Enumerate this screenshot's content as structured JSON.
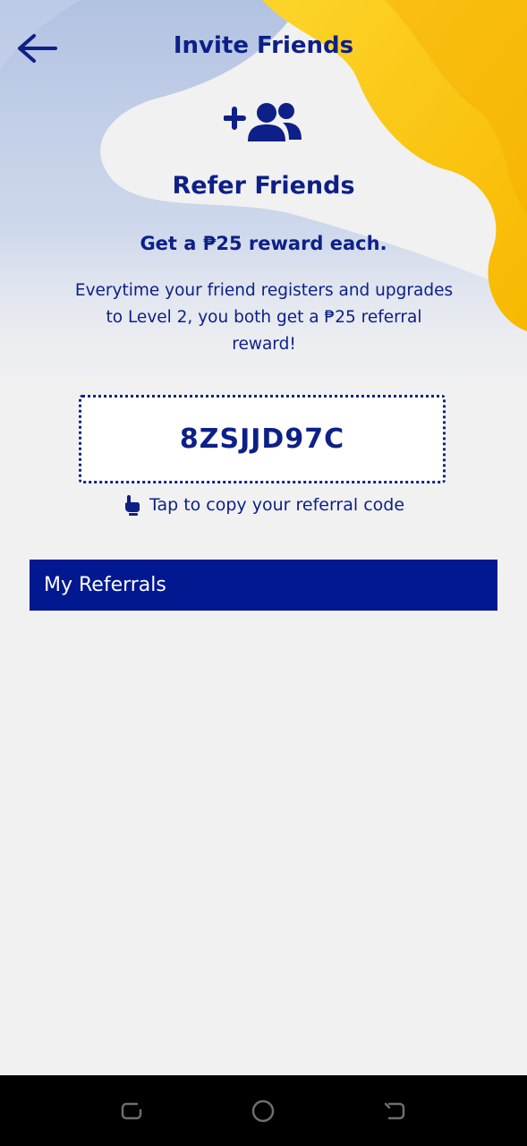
{
  "header": {
    "title": "Invite Friends",
    "back_icon": "arrow-left-icon"
  },
  "hero": {
    "icon": "add-user-group-icon",
    "title": "Refer Friends",
    "subtitle": "Get a ₱25 reward each.",
    "description": "Everytime your friend registers and upgrades to Level 2, you both get a ₱25 referral reward!"
  },
  "referral": {
    "code": "8ZSJJD97C",
    "hint_icon": "pointing-hand-icon",
    "hint": "Tap to copy your referral code"
  },
  "referrals_section": {
    "title": "My Referrals"
  },
  "system_nav": {
    "icons": [
      "recents-icon",
      "home-icon",
      "back-icon"
    ]
  },
  "colors": {
    "primary": "#0d2088",
    "section_bar": "#021890",
    "accent_yellow": "#fcc200",
    "background": "#f1f1f1"
  }
}
